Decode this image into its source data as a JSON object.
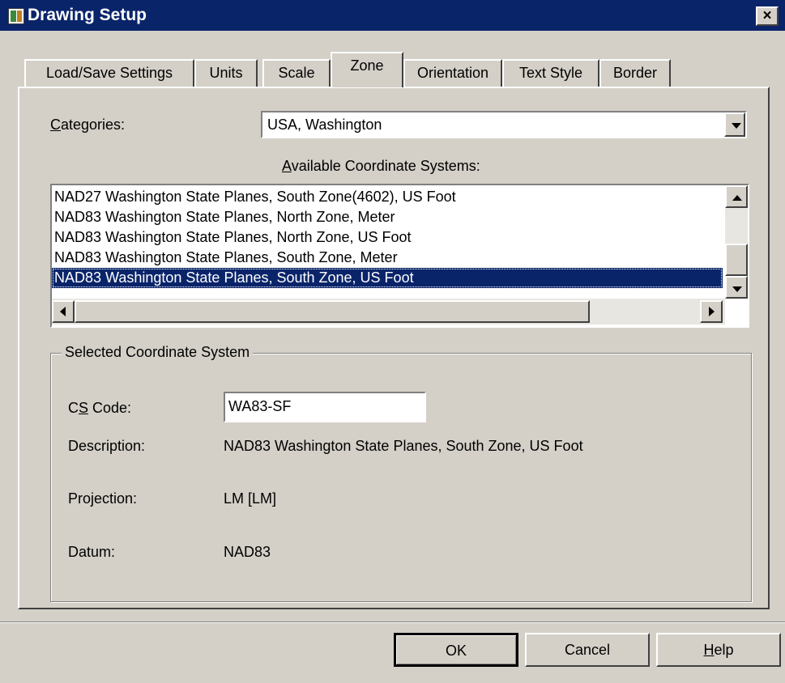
{
  "window": {
    "title": "Drawing Setup",
    "close_label": "×"
  },
  "tabs": [
    {
      "label": "Load/Save Settings"
    },
    {
      "label": "Units"
    },
    {
      "label": "Scale"
    },
    {
      "label": "Zone",
      "active": true
    },
    {
      "label": "Orientation"
    },
    {
      "label": "Text Style"
    },
    {
      "label": "Border"
    }
  ],
  "zone": {
    "categories_label": "ategories:",
    "categories_label_mnemonic": "C",
    "categories_value": "USA, Washington",
    "available_label": "vailable Coordinate Systems:",
    "available_label_mnemonic": "A",
    "coordinate_systems": [
      "NAD27 Washington State Planes, South Zone(4602), US Foot",
      "NAD83 Washington State Planes, North Zone, Meter",
      "NAD83 Washington State Planes, North Zone, US Foot",
      "NAD83 Washington State Planes, South Zone, Meter",
      "NAD83 Washington State Planes, South Zone, US Foot"
    ],
    "selected_index": 4
  },
  "selected": {
    "group_title": "Selected Coordinate System",
    "cs_code_label_pre": "C",
    "cs_code_label_mnemonic": "S",
    "cs_code_label_post": " Code:",
    "cs_code_value": "WA83-SF",
    "description_label": "Description:",
    "description_value": "NAD83 Washington State Planes, South Zone, US Foot",
    "projection_label": "Projection:",
    "projection_value": "LM [LM]",
    "datum_label": "Datum:",
    "datum_value": "NAD83"
  },
  "buttons": {
    "ok": "OK",
    "cancel": "Cancel",
    "help_mnemonic": "H",
    "help_rest": "elp"
  },
  "colors": {
    "title_bar": "#0a246a",
    "face": "#d4d0c8",
    "selection": "#0a246a"
  }
}
